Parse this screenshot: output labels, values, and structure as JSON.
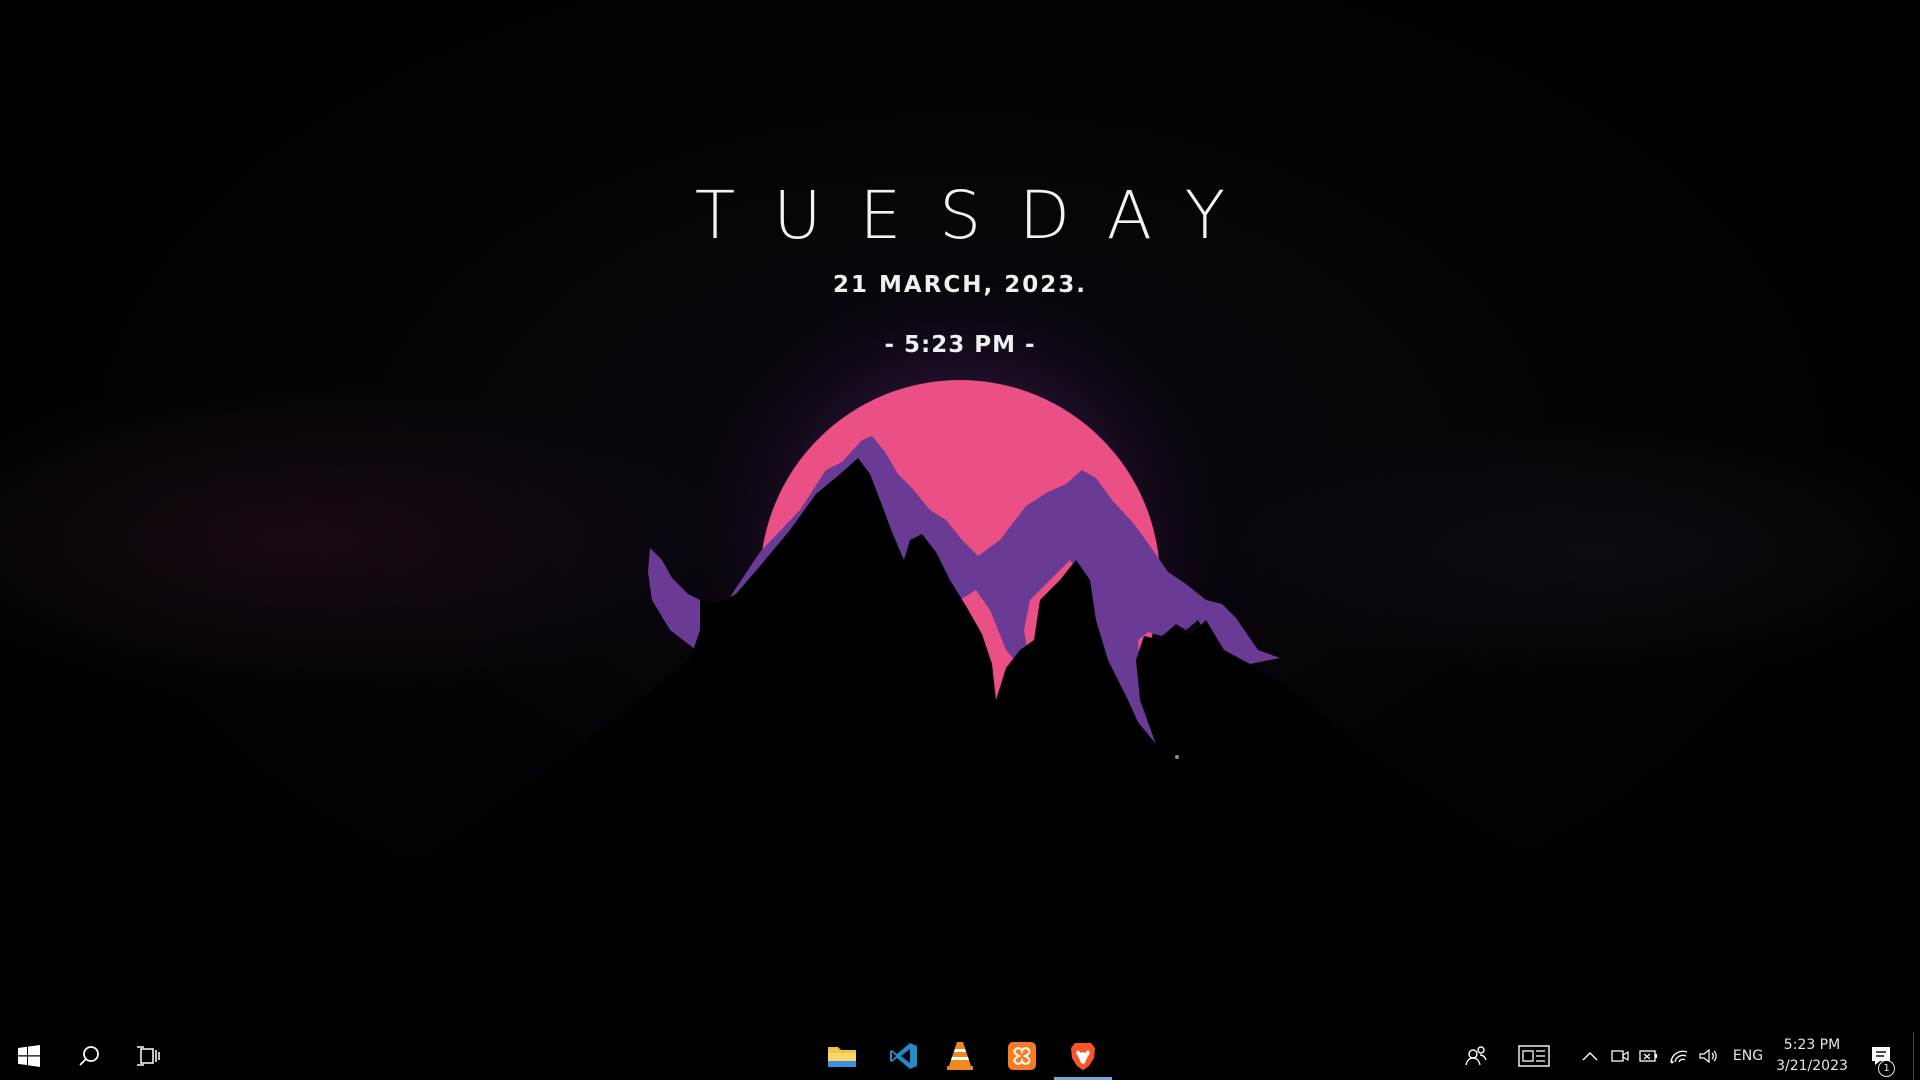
{
  "wallpaper": {
    "day": "TUESDAY",
    "date": "21 MARCH, 2023.",
    "time": "- 5:23 PM -",
    "colors": {
      "sun": "#ea4f85",
      "mountain": "#6a3b94",
      "background": "#000000"
    }
  },
  "taskbar": {
    "start": {
      "icon": "windows-logo-icon"
    },
    "search": {
      "icon": "search-icon"
    },
    "task_view": {
      "icon": "task-view-icon"
    },
    "pinned_apps": [
      {
        "name": "File Explorer",
        "icon": "folder-icon",
        "active": false
      },
      {
        "name": "Visual Studio Code",
        "icon": "vscode-icon",
        "active": false
      },
      {
        "name": "VLC media player",
        "icon": "vlc-cone-icon",
        "active": false
      },
      {
        "name": "XAMPP",
        "icon": "xampp-icon",
        "active": false
      },
      {
        "name": "Brave",
        "icon": "brave-lion-icon",
        "active": true
      }
    ],
    "tray": {
      "people_icon": "people-icon",
      "news_icon": "news-widget-icon",
      "overflow_icon": "chevron-up-icon",
      "meet_icon": "meet-now-icon",
      "battery_icon": "battery-icon",
      "network_icon": "wifi-icon",
      "volume_icon": "speaker-icon",
      "language": "ENG",
      "time": "5:23 PM",
      "date": "3/21/2023",
      "notification_count": "1"
    }
  }
}
